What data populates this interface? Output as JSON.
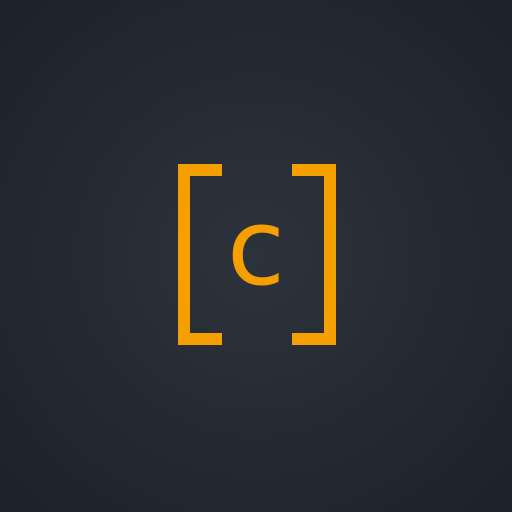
{
  "logo": {
    "letter": "c",
    "accent_color": "#f5a000",
    "background_color": "#262b33",
    "icon_name": "bracketed-c-logo"
  }
}
